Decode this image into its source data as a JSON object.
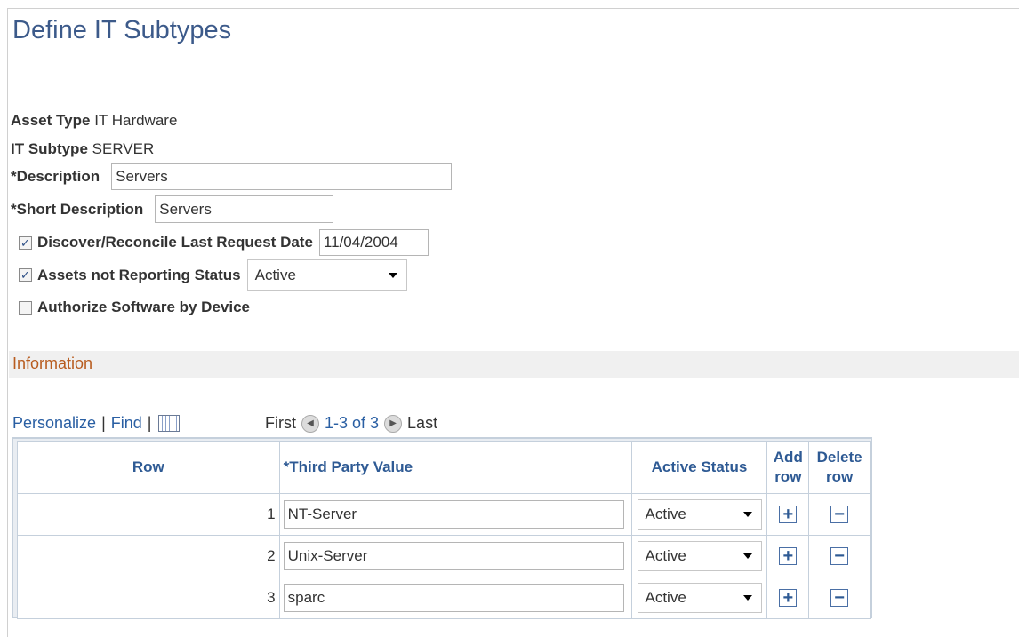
{
  "page": {
    "title": "Define IT Subtypes"
  },
  "fields": {
    "asset_type_label": "Asset Type",
    "asset_type_value": "IT Hardware",
    "it_subtype_label": "IT Subtype",
    "it_subtype_value": "SERVER",
    "description_label": "*Description",
    "description_value": "Servers",
    "short_description_label": "*Short Description",
    "short_description_value": "Servers",
    "discover_label": "Discover/Reconcile",
    "discover_checked": true,
    "last_request_date_label": "Last Request Date",
    "last_request_date_value": "11/04/2004",
    "assets_not_reporting_label": "Assets not Reporting",
    "assets_not_reporting_checked": true,
    "status_label": "Status",
    "status_value": "Active",
    "authorize_label": "Authorize Software by Device",
    "authorize_checked": false
  },
  "section": {
    "title": "Information"
  },
  "grid_nav": {
    "personalize": "Personalize",
    "find": "Find",
    "first": "First",
    "range": "1-3 of 3",
    "last": "Last"
  },
  "table": {
    "headers": {
      "row": "Row",
      "third_party_value": "*Third Party Value",
      "active_status": "Active Status",
      "add_row_1": "Add",
      "add_row_2": "row",
      "delete_row_1": "Delete",
      "delete_row_2": "row"
    },
    "rows": [
      {
        "num": "1",
        "value": "NT-Server",
        "status": "Active"
      },
      {
        "num": "2",
        "value": "Unix-Server",
        "status": "Active"
      },
      {
        "num": "3",
        "value": "sparc",
        "status": "Active"
      }
    ]
  },
  "icons": {
    "checkbox_mark": "✓",
    "add": "+",
    "delete": "−",
    "prev": "◀",
    "next": "▶"
  }
}
